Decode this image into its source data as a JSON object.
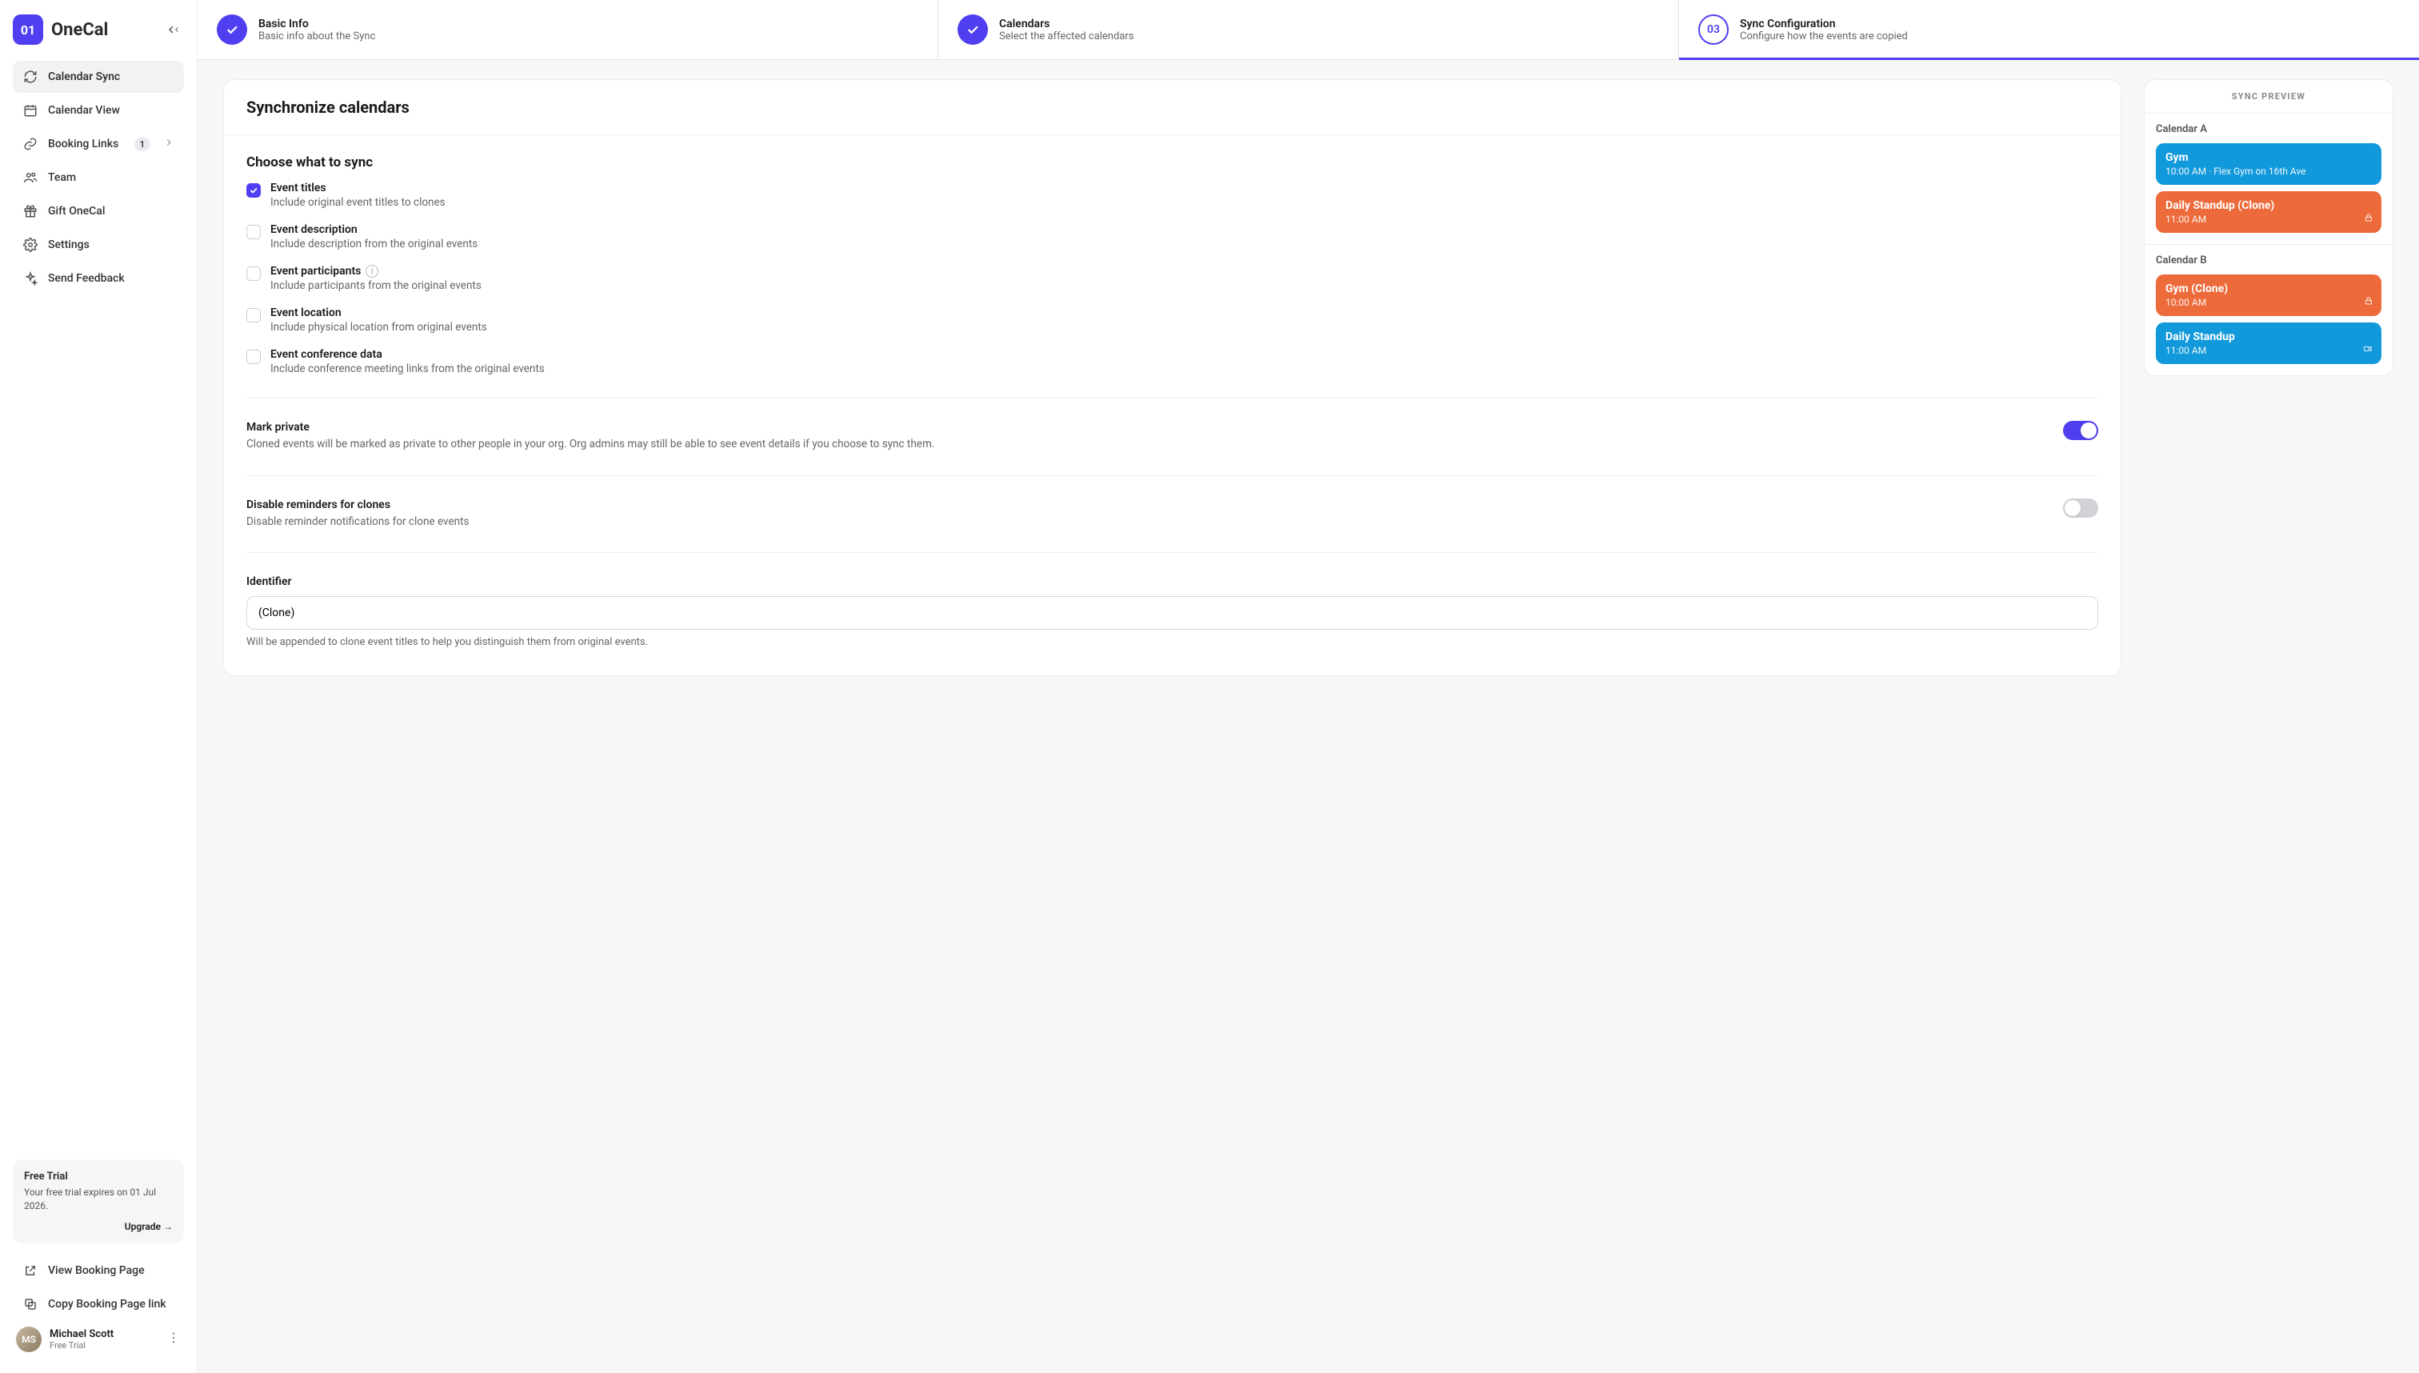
{
  "brand": {
    "logo_short": "01",
    "logo_text": "OneCal"
  },
  "sidebar": {
    "items": [
      {
        "label": "Calendar Sync"
      },
      {
        "label": "Calendar View"
      },
      {
        "label": "Booking Links",
        "badge": "1"
      },
      {
        "label": "Team"
      },
      {
        "label": "Gift OneCal"
      },
      {
        "label": "Settings"
      },
      {
        "label": "Send Feedback"
      }
    ],
    "trial": {
      "title": "Free Trial",
      "desc": "Your free trial expires on 01 Jul 2026.",
      "upgrade": "Upgrade →"
    },
    "extras": [
      {
        "label": "View Booking Page"
      },
      {
        "label": "Copy Booking Page link"
      }
    ]
  },
  "profile": {
    "name": "Michael Scott",
    "plan": "Free Trial",
    "initials": "MS"
  },
  "stepper": {
    "steps": [
      {
        "title": "Basic Info",
        "sub": "Basic info about the Sync"
      },
      {
        "title": "Calendars",
        "sub": "Select the affected calendars"
      },
      {
        "num": "03",
        "title": "Sync Configuration",
        "sub": "Configure how the events are copied"
      }
    ]
  },
  "main": {
    "heading": "Synchronize calendars",
    "choose_title": "Choose what to sync",
    "options": [
      {
        "title": "Event titles",
        "desc": "Include original event titles to clones",
        "checked": true
      },
      {
        "title": "Event description",
        "desc": "Include description from the original events",
        "checked": false
      },
      {
        "title": "Event participants",
        "desc": "Include participants from the original events",
        "checked": false,
        "info": true
      },
      {
        "title": "Event location",
        "desc": "Include physical location from original events",
        "checked": false
      },
      {
        "title": "Event conference data",
        "desc": "Include conference meeting links from the original events",
        "checked": false
      }
    ],
    "mark_private": {
      "title": "Mark private",
      "desc": "Cloned events will be marked as private to other people in your org. Org admins may still be able to see event details if you choose to sync them.",
      "on": true
    },
    "disable_reminders": {
      "title": "Disable reminders for clones",
      "desc": "Disable reminder notifications for clone events",
      "on": false
    },
    "identifier": {
      "label": "Identifier",
      "value": "(Clone)",
      "help": "Will be appended to clone event titles to help you distinguish them from original events."
    }
  },
  "preview": {
    "header": "SYNC PREVIEW",
    "calA": {
      "label": "Calendar A",
      "events": [
        {
          "title": "Gym",
          "time": "10:00 AM",
          "loc": "Flex Gym on 16th Ave",
          "color": "blue"
        },
        {
          "title": "Daily Standup (Clone)",
          "time": "11:00 AM",
          "color": "orange",
          "icon": "lock"
        }
      ]
    },
    "calB": {
      "label": "Calendar B",
      "events": [
        {
          "title": "Gym (Clone)",
          "time": "10:00 AM",
          "color": "orange",
          "icon": "lock"
        },
        {
          "title": "Daily Standup",
          "time": "11:00 AM",
          "color": "blue",
          "icon": "video"
        }
      ]
    }
  }
}
